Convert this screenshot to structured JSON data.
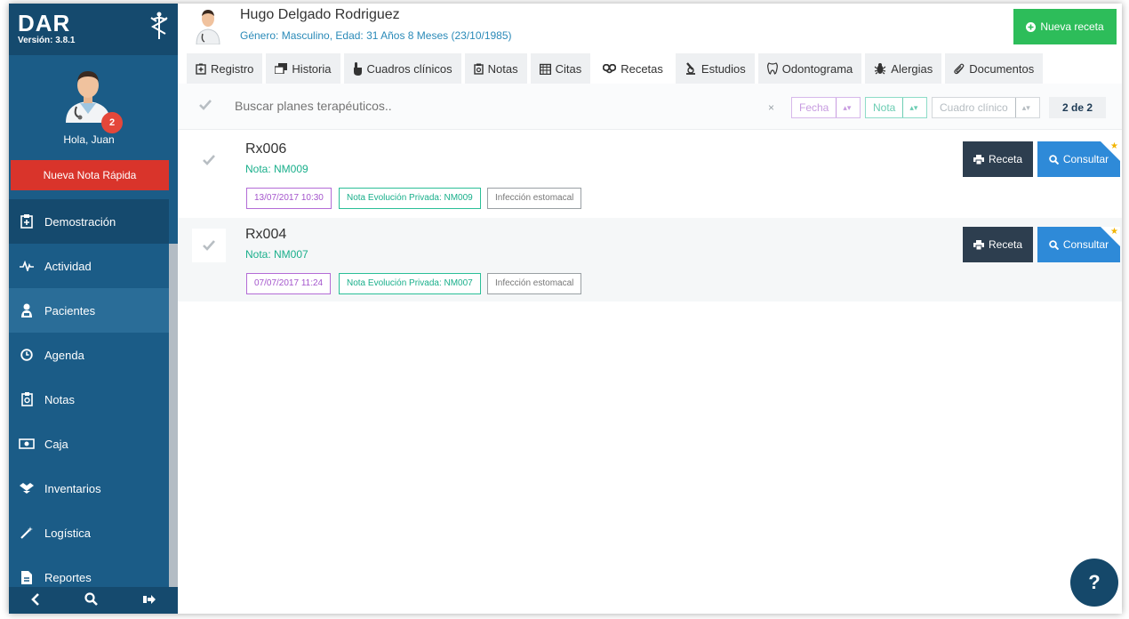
{
  "app": {
    "brand": "DAR",
    "version": "Versión: 3.8.1"
  },
  "profile": {
    "greeting": "Hola, Juan",
    "badge_count": "2",
    "quick_note_label": "Nueva Nota Rápida"
  },
  "nav": {
    "items": [
      {
        "label": "Demostración",
        "icon": "clipboard-icon"
      },
      {
        "label": "Actividad",
        "icon": "pulse-icon"
      },
      {
        "label": "Pacientes",
        "icon": "user-icon"
      },
      {
        "label": "Agenda",
        "icon": "clock-icon"
      },
      {
        "label": "Notas",
        "icon": "clipboard-note-icon"
      },
      {
        "label": "Caja",
        "icon": "money-icon"
      },
      {
        "label": "Inventarios",
        "icon": "dropbox-icon"
      },
      {
        "label": "Logística",
        "icon": "wand-icon"
      },
      {
        "label": "Reportes",
        "icon": "file-icon"
      }
    ]
  },
  "patient": {
    "name": "Hugo Delgado Rodriguez",
    "info": "Género: Masculino, Edad: 31 Años 8 Meses (23/10/1985)"
  },
  "header": {
    "new_rx_label": "Nueva receta"
  },
  "tabs": [
    {
      "label": "Registro",
      "icon": "medkit-icon"
    },
    {
      "label": "Historia",
      "icon": "windows-icon"
    },
    {
      "label": "Cuadros clínicos",
      "icon": "hand-pointer-icon"
    },
    {
      "label": "Notas",
      "icon": "clipboard-note-icon"
    },
    {
      "label": "Citas",
      "icon": "calendar-icon"
    },
    {
      "label": "Recetas",
      "icon": "pills-icon"
    },
    {
      "label": "Estudios",
      "icon": "microscope-icon"
    },
    {
      "label": "Odontograma",
      "icon": "tooth-icon"
    },
    {
      "label": "Alergias",
      "icon": "bug-icon"
    },
    {
      "label": "Documentos",
      "icon": "paperclip-icon"
    }
  ],
  "search": {
    "placeholder": "Buscar planes terapéuticos..",
    "clear": "×",
    "filters": {
      "fecha": "Fecha",
      "nota": "Nota",
      "cuadro": "Cuadro clínico"
    },
    "count": "2 de 2"
  },
  "prescriptions": [
    {
      "title": "Rx006",
      "note": "Nota: NM009",
      "date": "13/07/2017 10:30",
      "note_tag": "Nota Evolución Privada: NM009",
      "condition": "Infección estomacal"
    },
    {
      "title": "Rx004",
      "note": "Nota: NM007",
      "date": "07/07/2017 11:24",
      "note_tag": "Nota Evolución Privada: NM007",
      "condition": "Infección estomacal"
    }
  ],
  "actions": {
    "receta": "Receta",
    "consultar": "Consultar"
  },
  "help": "?"
}
